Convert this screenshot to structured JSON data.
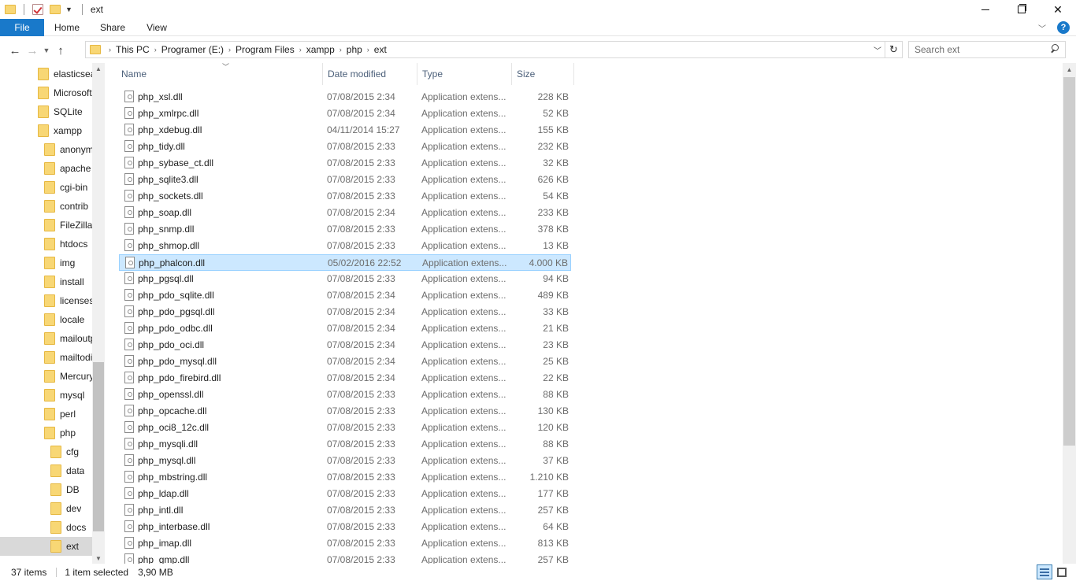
{
  "window": {
    "title": "ext"
  },
  "ribbon": {
    "tabs": [
      {
        "label": "File"
      },
      {
        "label": "Home"
      },
      {
        "label": "Share"
      },
      {
        "label": "View"
      }
    ]
  },
  "address": {
    "crumbs": [
      "This PC",
      "Programer (E:)",
      "Program Files",
      "xampp",
      "php",
      "ext"
    ]
  },
  "search": {
    "placeholder": "Search ext"
  },
  "nav_tree": [
    {
      "label": "elasticsearch"
    },
    {
      "label": "Microsoft"
    },
    {
      "label": "SQLite"
    },
    {
      "label": "xampp"
    },
    {
      "label": "anonymous"
    },
    {
      "label": "apache"
    },
    {
      "label": "cgi-bin"
    },
    {
      "label": "contrib"
    },
    {
      "label": "FileZilla"
    },
    {
      "label": "htdocs"
    },
    {
      "label": "img"
    },
    {
      "label": "install"
    },
    {
      "label": "licenses"
    },
    {
      "label": "locale"
    },
    {
      "label": "mailoutput"
    },
    {
      "label": "mailtodisk"
    },
    {
      "label": "Mercury"
    },
    {
      "label": "mysql"
    },
    {
      "label": "perl"
    },
    {
      "label": "php"
    },
    {
      "label": "cfg"
    },
    {
      "label": "data"
    },
    {
      "label": "DB"
    },
    {
      "label": "dev"
    },
    {
      "label": "docs"
    },
    {
      "label": "ext"
    }
  ],
  "columns": {
    "name": "Name",
    "date": "Date modified",
    "type": "Type",
    "size": "Size"
  },
  "files": [
    {
      "name": "php_xsl.dll",
      "date": "07/08/2015 2:34",
      "type": "Application extens...",
      "size": "228 KB"
    },
    {
      "name": "php_xmlrpc.dll",
      "date": "07/08/2015 2:34",
      "type": "Application extens...",
      "size": "52 KB"
    },
    {
      "name": "php_xdebug.dll",
      "date": "04/11/2014 15:27",
      "type": "Application extens...",
      "size": "155 KB"
    },
    {
      "name": "php_tidy.dll",
      "date": "07/08/2015 2:33",
      "type": "Application extens...",
      "size": "232 KB"
    },
    {
      "name": "php_sybase_ct.dll",
      "date": "07/08/2015 2:33",
      "type": "Application extens...",
      "size": "32 KB"
    },
    {
      "name": "php_sqlite3.dll",
      "date": "07/08/2015 2:33",
      "type": "Application extens...",
      "size": "626 KB"
    },
    {
      "name": "php_sockets.dll",
      "date": "07/08/2015 2:33",
      "type": "Application extens...",
      "size": "54 KB"
    },
    {
      "name": "php_soap.dll",
      "date": "07/08/2015 2:34",
      "type": "Application extens...",
      "size": "233 KB"
    },
    {
      "name": "php_snmp.dll",
      "date": "07/08/2015 2:33",
      "type": "Application extens...",
      "size": "378 KB"
    },
    {
      "name": "php_shmop.dll",
      "date": "07/08/2015 2:33",
      "type": "Application extens...",
      "size": "13 KB"
    },
    {
      "name": "php_phalcon.dll",
      "date": "05/02/2016 22:52",
      "type": "Application extens...",
      "size": "4.000 KB",
      "selected": true
    },
    {
      "name": "php_pgsql.dll",
      "date": "07/08/2015 2:33",
      "type": "Application extens...",
      "size": "94 KB"
    },
    {
      "name": "php_pdo_sqlite.dll",
      "date": "07/08/2015 2:34",
      "type": "Application extens...",
      "size": "489 KB"
    },
    {
      "name": "php_pdo_pgsql.dll",
      "date": "07/08/2015 2:34",
      "type": "Application extens...",
      "size": "33 KB"
    },
    {
      "name": "php_pdo_odbc.dll",
      "date": "07/08/2015 2:34",
      "type": "Application extens...",
      "size": "21 KB"
    },
    {
      "name": "php_pdo_oci.dll",
      "date": "07/08/2015 2:34",
      "type": "Application extens...",
      "size": "23 KB"
    },
    {
      "name": "php_pdo_mysql.dll",
      "date": "07/08/2015 2:34",
      "type": "Application extens...",
      "size": "25 KB"
    },
    {
      "name": "php_pdo_firebird.dll",
      "date": "07/08/2015 2:34",
      "type": "Application extens...",
      "size": "22 KB"
    },
    {
      "name": "php_openssl.dll",
      "date": "07/08/2015 2:33",
      "type": "Application extens...",
      "size": "88 KB"
    },
    {
      "name": "php_opcache.dll",
      "date": "07/08/2015 2:33",
      "type": "Application extens...",
      "size": "130 KB"
    },
    {
      "name": "php_oci8_12c.dll",
      "date": "07/08/2015 2:33",
      "type": "Application extens...",
      "size": "120 KB"
    },
    {
      "name": "php_mysqli.dll",
      "date": "07/08/2015 2:33",
      "type": "Application extens...",
      "size": "88 KB"
    },
    {
      "name": "php_mysql.dll",
      "date": "07/08/2015 2:33",
      "type": "Application extens...",
      "size": "37 KB"
    },
    {
      "name": "php_mbstring.dll",
      "date": "07/08/2015 2:33",
      "type": "Application extens...",
      "size": "1.210 KB"
    },
    {
      "name": "php_ldap.dll",
      "date": "07/08/2015 2:33",
      "type": "Application extens...",
      "size": "177 KB"
    },
    {
      "name": "php_intl.dll",
      "date": "07/08/2015 2:33",
      "type": "Application extens...",
      "size": "257 KB"
    },
    {
      "name": "php_interbase.dll",
      "date": "07/08/2015 2:33",
      "type": "Application extens...",
      "size": "64 KB"
    },
    {
      "name": "php_imap.dll",
      "date": "07/08/2015 2:33",
      "type": "Application extens...",
      "size": "813 KB"
    },
    {
      "name": "php_gmp.dll",
      "date": "07/08/2015 2:33",
      "type": "Application extens...",
      "size": "257 KB"
    }
  ],
  "status": {
    "item_count": "37 items",
    "selection": "1 item selected",
    "selection_size": "3,90 MB"
  },
  "colors": {
    "accent": "#1979ca",
    "selection_bg": "#cce8ff",
    "selection_border": "#99d1ff"
  }
}
